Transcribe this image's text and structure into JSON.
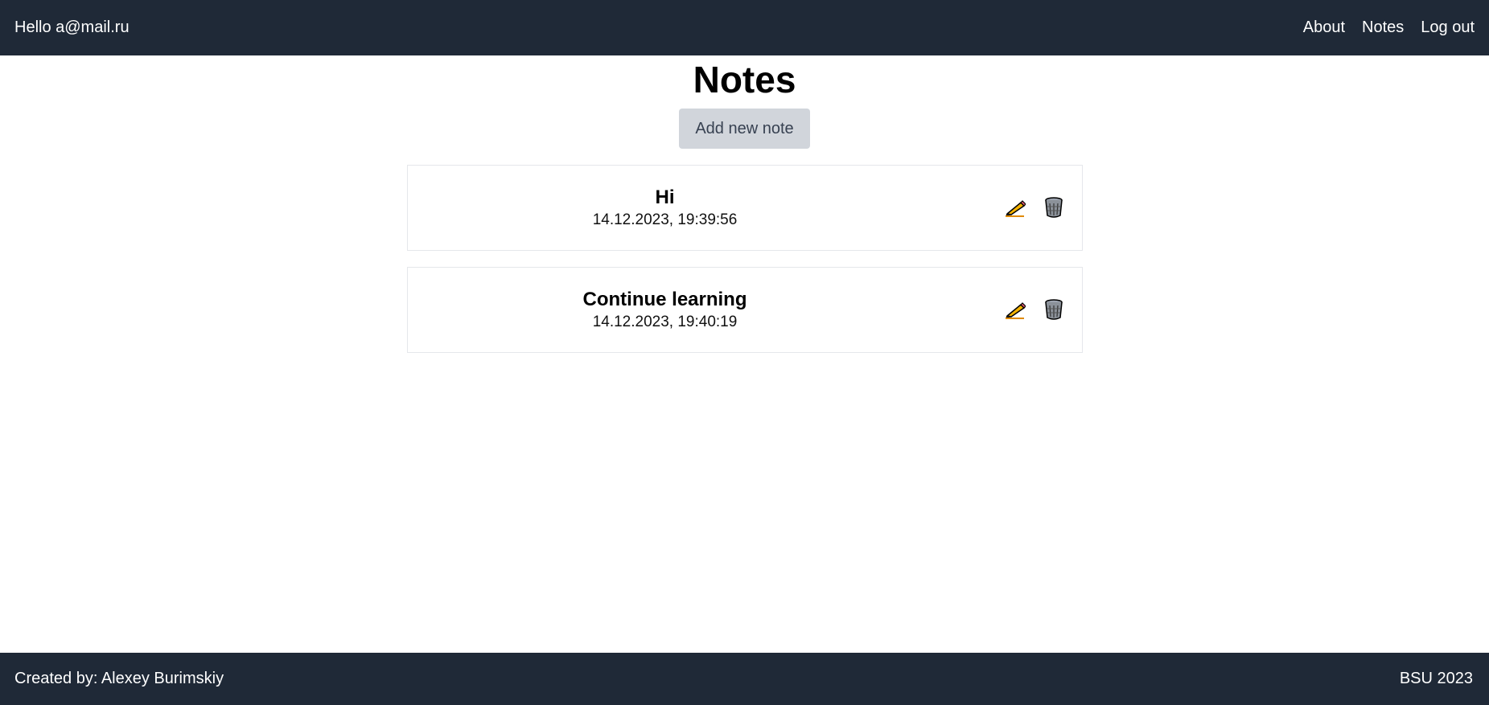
{
  "header": {
    "greeting": "Hello a@mail.ru",
    "nav": [
      {
        "label": "About"
      },
      {
        "label": "Notes"
      },
      {
        "label": "Log out"
      }
    ]
  },
  "main": {
    "title": "Notes",
    "add_button_label": "Add new note",
    "notes": [
      {
        "title": "Hi",
        "date": "14.12.2023, 19:39:56",
        "edit_icon": "pencil-icon",
        "delete_icon": "trash-icon"
      },
      {
        "title": "Continue learning",
        "date": "14.12.2023, 19:40:19",
        "edit_icon": "pencil-icon",
        "delete_icon": "trash-icon"
      }
    ]
  },
  "footer": {
    "credits": "Created by: Alexey Burimskiy",
    "org": "BSU 2023"
  },
  "colors": {
    "navbar_bg": "#1f2937",
    "button_bg": "#d1d5db",
    "card_border": "#e5e7eb"
  }
}
